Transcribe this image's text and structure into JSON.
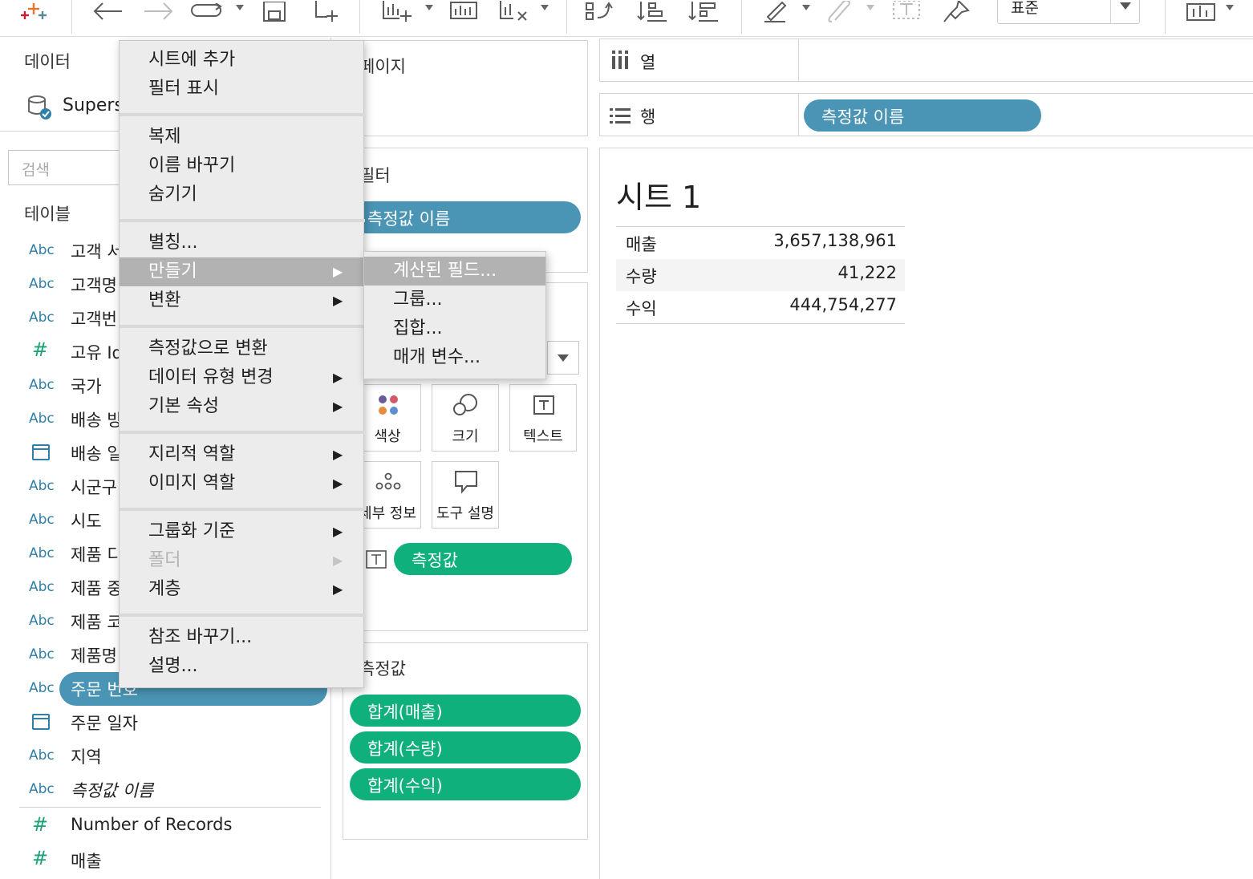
{
  "toolbar": {
    "zoom_value": "표준"
  },
  "data_pane": {
    "title": "데이터",
    "datasource": "Supers",
    "search_placeholder": "검색",
    "tables_label": "테이블",
    "fields": [
      {
        "type": "Abc",
        "name": "고객 서"
      },
      {
        "type": "Abc",
        "name": "고객명"
      },
      {
        "type": "Abc",
        "name": "고객번"
      },
      {
        "type": "#",
        "name": "고유 Id"
      },
      {
        "type": "Abc",
        "name": "국가"
      },
      {
        "type": "Abc",
        "name": "배송 방"
      },
      {
        "type": "date",
        "name": "배송 일"
      },
      {
        "type": "Abc",
        "name": "시군구"
      },
      {
        "type": "Abc",
        "name": "시도"
      },
      {
        "type": "Abc",
        "name": "제품 디"
      },
      {
        "type": "Abc",
        "name": "제품 중"
      },
      {
        "type": "Abc",
        "name": "제품 코"
      },
      {
        "type": "Abc",
        "name": "제품명"
      },
      {
        "type": "Abc",
        "name": "주문 번호"
      },
      {
        "type": "date",
        "name": "주문 일자"
      },
      {
        "type": "Abc",
        "name": "지역"
      },
      {
        "type": "Abc",
        "name": "측정값 이름"
      },
      {
        "type": "#",
        "name": "Number of Records"
      },
      {
        "type": "#",
        "name": "매출"
      }
    ]
  },
  "pages_card": {
    "title": "페이지"
  },
  "filters_card": {
    "title": "필터",
    "pill": "측정값 이름"
  },
  "marks_card": {
    "buttons": [
      "색상",
      "크기",
      "텍스트",
      "세부 정보",
      "도구 설명"
    ],
    "text_pill": "측정값"
  },
  "measure_values_card": {
    "title": "측정값",
    "pills": [
      "합계(매출)",
      "합계(수량)",
      "합계(수익)"
    ]
  },
  "shelves": {
    "columns_label": "열",
    "rows_label": "행",
    "rows_pill": "측정값 이름"
  },
  "view": {
    "sheet_title": "시트 1",
    "rows": [
      {
        "label": "매출",
        "value": "3,657,138,961"
      },
      {
        "label": "수량",
        "value": "41,222"
      },
      {
        "label": "수익",
        "value": "444,754,277"
      }
    ]
  },
  "context_menu": {
    "items": [
      {
        "label": "시트에 추가"
      },
      {
        "label": "필터 표시"
      },
      {
        "label": "복제"
      },
      {
        "label": "이름 바꾸기"
      },
      {
        "label": "숨기기"
      },
      {
        "label": "별칭..."
      },
      {
        "label": "만들기",
        "arrow": "▶"
      },
      {
        "label": "변환",
        "arrow": "▶"
      },
      {
        "label": "측정값으로 변환"
      },
      {
        "label": "데이터 유형 변경",
        "arrow": "▶"
      },
      {
        "label": "기본 속성",
        "arrow": "▶"
      },
      {
        "label": "지리적 역할",
        "arrow": "▶"
      },
      {
        "label": "이미지 역할",
        "arrow": "▶"
      },
      {
        "label": "그룹화 기준",
        "arrow": "▶"
      },
      {
        "label": "폴더",
        "arrow": "▶"
      },
      {
        "label": "계층",
        "arrow": "▶"
      },
      {
        "label": "참조 바꾸기..."
      },
      {
        "label": "설명..."
      }
    ]
  },
  "submenu": {
    "items": [
      "계산된 필드...",
      "그룹...",
      "집합...",
      "매개 변수..."
    ]
  },
  "colors": {
    "dimension_blue": "#4a95b5",
    "measure_green": "#10b07c",
    "menu_highlight": "#b2b2b2"
  }
}
